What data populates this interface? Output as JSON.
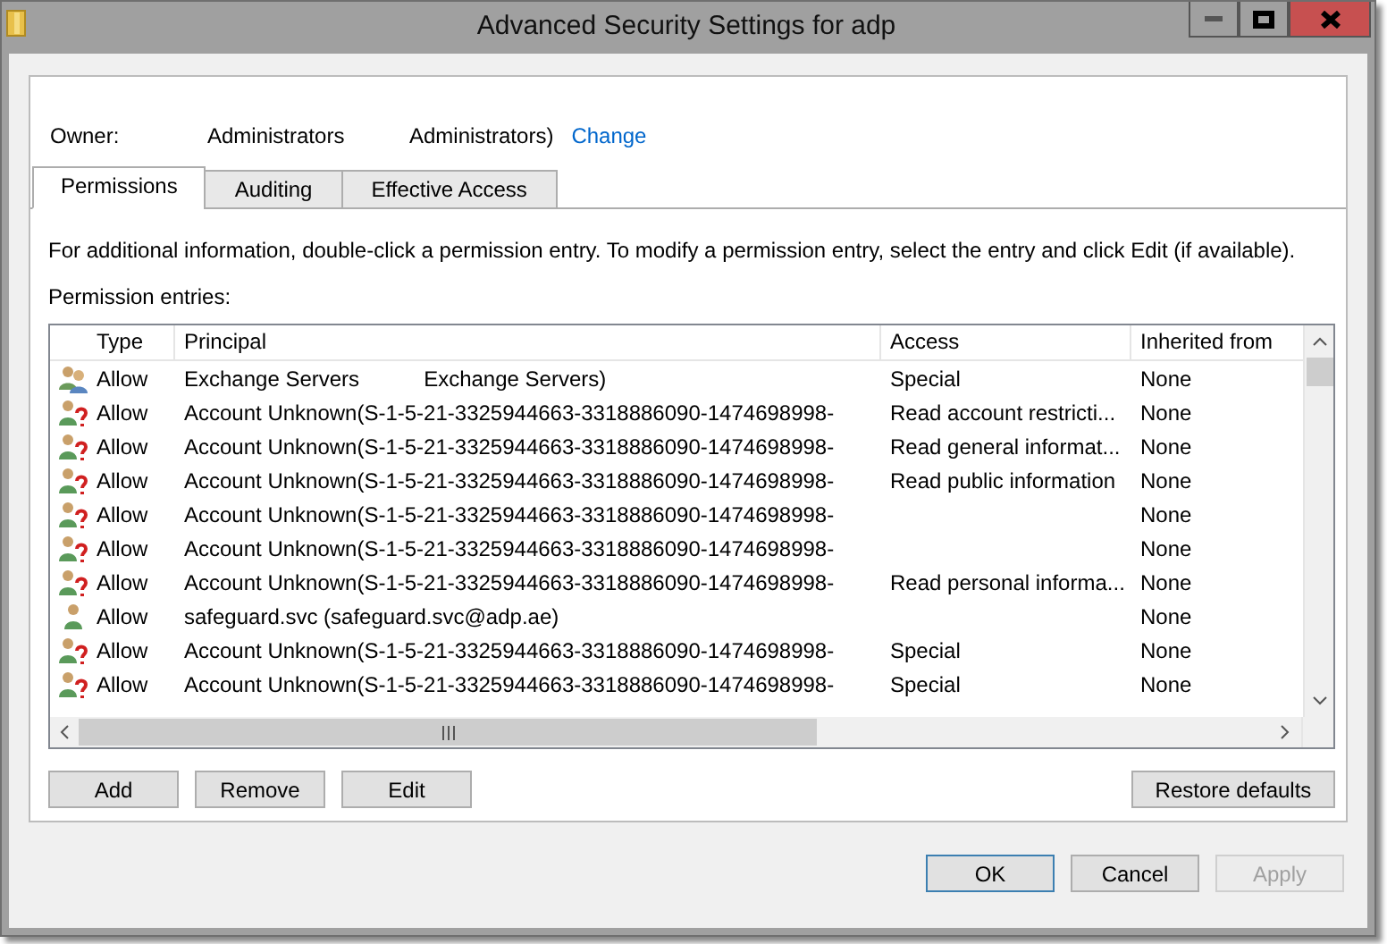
{
  "window": {
    "title": "Advanced Security Settings for adp"
  },
  "owner": {
    "label": "Owner:",
    "name": "Administrators",
    "name_2": "Administrators)",
    "link": "Change"
  },
  "tabs": [
    {
      "label": "Permissions",
      "selected": true
    },
    {
      "label": "Auditing",
      "selected": false
    },
    {
      "label": "Effective Access",
      "selected": false
    }
  ],
  "info_text": "For additional information, double-click a permission entry. To modify a permission entry, select the entry and click Edit (if available).",
  "entries_label": "Permission entries:",
  "table": {
    "columns": [
      "Type",
      "Principal",
      "Access",
      "Inherited from"
    ],
    "rows": [
      {
        "kind": "group",
        "type": "Allow",
        "principal": "Exchange Servers",
        "principal_2": "Exchange Servers)",
        "access": "Special",
        "inherited": "None"
      },
      {
        "kind": "unknown",
        "type": "Allow",
        "principal": "Account Unknown(S-1-5-21-3325944663-3318886090-1474698998-",
        "access": "Read account restricti...",
        "inherited": "None"
      },
      {
        "kind": "unknown",
        "type": "Allow",
        "principal": "Account Unknown(S-1-5-21-3325944663-3318886090-1474698998-",
        "access": "Read general informat...",
        "inherited": "None"
      },
      {
        "kind": "unknown",
        "type": "Allow",
        "principal": "Account Unknown(S-1-5-21-3325944663-3318886090-1474698998-",
        "access": "Read public information",
        "inherited": "None"
      },
      {
        "kind": "unknown",
        "type": "Allow",
        "principal": "Account Unknown(S-1-5-21-3325944663-3318886090-1474698998-",
        "inherited": "None"
      },
      {
        "kind": "unknown",
        "type": "Allow",
        "principal": "Account Unknown(S-1-5-21-3325944663-3318886090-1474698998-",
        "inherited": "None"
      },
      {
        "kind": "unknown",
        "type": "Allow",
        "principal": "Account Unknown(S-1-5-21-3325944663-3318886090-1474698998-",
        "access": "Read personal informa...",
        "inherited": "None"
      },
      {
        "kind": "user",
        "type": "Allow",
        "principal": "safeguard.svc (safeguard.svc@adp.ae)",
        "inherited": "None"
      },
      {
        "kind": "unknown",
        "type": "Allow",
        "principal": "Account Unknown(S-1-5-21-3325944663-3318886090-1474698998-",
        "access": "Special",
        "inherited": "None"
      },
      {
        "kind": "unknown",
        "type": "Allow",
        "principal": "Account Unknown(S-1-5-21-3325944663-3318886090-1474698998-",
        "access": "Special",
        "inherited": "None"
      }
    ]
  },
  "entry_buttons": [
    {
      "label": "Add",
      "disabled": false
    },
    {
      "label": "Remove",
      "disabled": false
    },
    {
      "label": "Edit",
      "disabled": false
    }
  ],
  "restore_button": "Restore defaults",
  "dialog_buttons": [
    {
      "label": "OK",
      "disabled": false,
      "default": true
    },
    {
      "label": "Cancel",
      "disabled": false,
      "default": false
    },
    {
      "label": "Apply",
      "disabled": true,
      "default": false
    }
  ]
}
